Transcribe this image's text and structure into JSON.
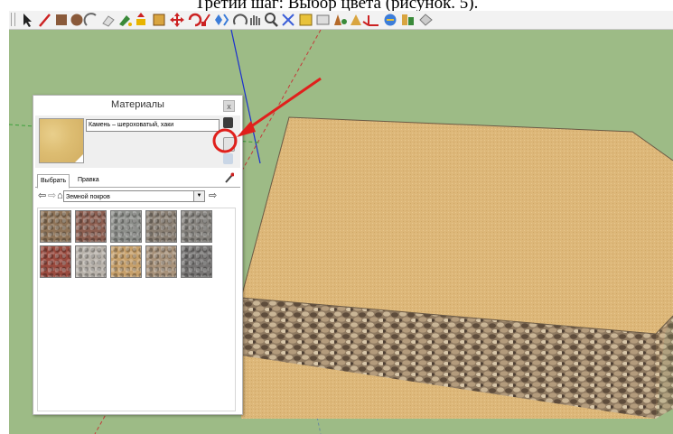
{
  "caption": "Третий шаг: Выбор цвета (рисунок. 5).",
  "toolbar": {
    "buttons": [
      "select-icon",
      "pencil-icon",
      "rectangle-icon",
      "circle-icon",
      "arc-icon",
      "eraser-icon",
      "paint-bucket-icon",
      "push-pull-icon",
      "offset-icon",
      "move-icon",
      "rotate-icon",
      "scale-icon",
      "follow-me-icon",
      "orbit-icon",
      "pan-icon",
      "zoom-icon",
      "zoom-extents-icon",
      "tape-measure-icon",
      "dimension-icon",
      "protractor-icon",
      "text-icon",
      "axes-icon",
      "3d-text-icon",
      "section-plane-icon",
      "warehouse-icon"
    ]
  },
  "panel": {
    "title": "Материалы",
    "close": "x",
    "material_name": "Камень – шероховатый, хаки",
    "tabs": [
      "Выбрать",
      "Правка"
    ],
    "library": "Земной покров",
    "textures": [
      {
        "name": "gravel-brown",
        "color": "#8f7458"
      },
      {
        "name": "gravel-red",
        "color": "#8c5e50"
      },
      {
        "name": "gravel-grey-blue",
        "color": "#8d8f8b"
      },
      {
        "name": "gravel-grey-brown",
        "color": "#8a7f73"
      },
      {
        "name": "gravel-grey",
        "color": "#85827d"
      },
      {
        "name": "gravel-dark-red",
        "color": "#9a4a3e"
      },
      {
        "name": "stone-light-grey",
        "color": "#b9b3ab"
      },
      {
        "name": "stone-khaki",
        "color": "#c7a06a"
      },
      {
        "name": "pebbles-beige",
        "color": "#a8927a"
      },
      {
        "name": "gravel-dark-grey",
        "color": "#767473"
      }
    ]
  },
  "colors": {
    "viewport_bg": "#9dbb86",
    "block_top": "#ddb779",
    "block_side": "#8f7a61",
    "annotation": "#e0201c"
  }
}
